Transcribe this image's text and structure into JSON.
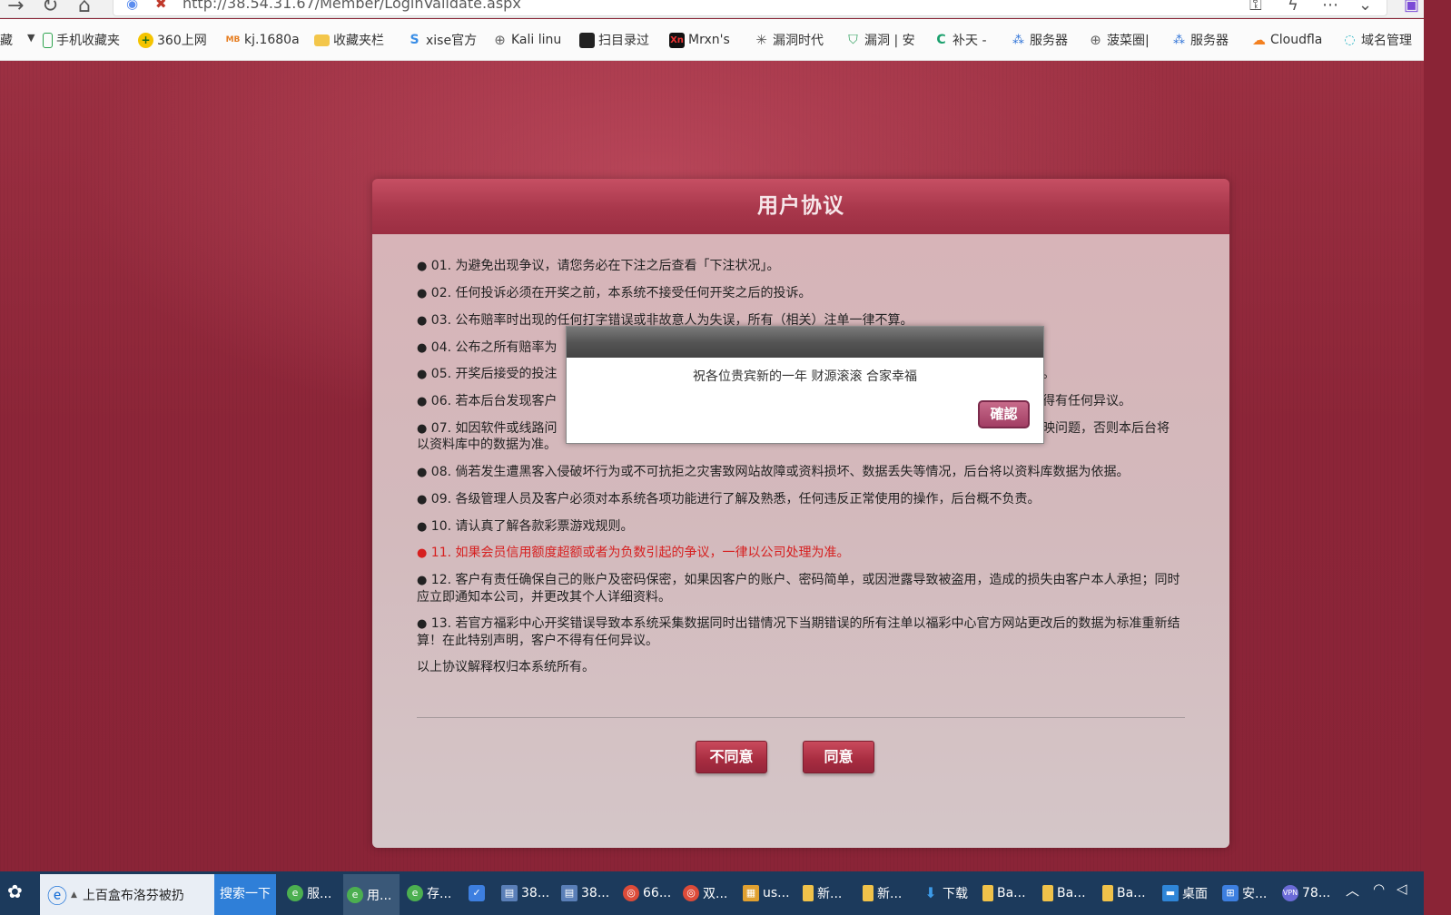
{
  "browser": {
    "url": "http://38.54.31.67/Member/LoginValidate.aspx",
    "bookmarks": [
      {
        "label": "藏",
        "icon": "bookmark-folder-icon"
      },
      {
        "label": "手机收藏夹",
        "icon": "phone-icon"
      },
      {
        "label": "360上网",
        "icon": "plus-globe-icon"
      },
      {
        "label": "kj.1680a",
        "icon": "mb-logo-icon"
      },
      {
        "label": "收藏夹栏",
        "icon": "folder-icon"
      },
      {
        "label": "xise官方",
        "icon": "s-logo-icon"
      },
      {
        "label": "Kali linu",
        "icon": "globe-icon"
      },
      {
        "label": "扫目录过",
        "icon": "dark-app-icon"
      },
      {
        "label": "Mrxn's",
        "icon": "xn-logo-icon"
      },
      {
        "label": "漏洞时代",
        "icon": "star-burst-icon"
      },
      {
        "label": "漏洞 | 安",
        "icon": "shield-icon"
      },
      {
        "label": "补天 -",
        "icon": "green-c-icon"
      },
      {
        "label": "服务器",
        "icon": "server-icon"
      },
      {
        "label": "菠菜圈|",
        "icon": "globe-icon"
      },
      {
        "label": "服务器",
        "icon": "server-icon"
      },
      {
        "label": "Cloudfla",
        "icon": "cloud-icon"
      },
      {
        "label": "域名管理",
        "icon": "domain-icon"
      }
    ]
  },
  "agreement": {
    "title": "用户协议",
    "clauses": [
      "01. 为避免出现争议，请您务必在下注之后查看「下注状况」。",
      "02. 任何投诉必须在开奖之前，本系统不接受任何开奖之后的投诉。",
      "03. 公布赔率时出现的任何打字错误或非故意人为失误，所有（相关）注单一律不算。",
      "04. 公布之所有赔率为",
      "05. 开奖后接受的投注",
      "06. 若本后台发现客户",
      "07. 如因软件或线路问",
      "08. 倘若发生遭黑客入侵破坏行为或不可抗拒之灾害致网站故障或资料损坏、数据丢失等情况，后台将以资料库数据为依据。",
      "09. 各级管理人员及客户必须对本系统各项功能进行了解及熟悉，任何违反正常使用的操作，后台概不负责。",
      "10. 请认真了解各款彩票游戏规则。",
      "11. 如果会员信用额度超额或者为负数引起的争议，一律以公司处理为准。",
      "12. 客户有责任确保自己的账户及密码保密，如果因客户的账户、密码简单，或因泄露导致被盗用，造成的损失由客户本人承担；同时应立即通知本公司，并更改其个人详细资料。",
      "13. 若官方福彩中心开奖错误导致本系统采集数据同时出错情况下当期错误的所有注单以福彩中心官方网站更改后的数据为标准重新结算！在此特别声明，客户不得有任何异议。"
    ],
    "fragment_06_right": "得有任何异议。",
    "fragment_07_right": "映问题，否则本后台将",
    "fragment_07_line2": "以资料库中的数据为准。",
    "fragment_05_right": "。",
    "footer_note": "以上协议解释权归本系统所有。",
    "disagree_label": "不同意",
    "agree_label": "同意",
    "highlight_color": "#d61f1f"
  },
  "dialog": {
    "message": "祝各位贵宾新的一年 财源滚滚 合家幸福",
    "ok_label": "確認"
  },
  "taskbar": {
    "ie_title": "上百盒布洛芬被扔",
    "search_label": "搜索一下",
    "items": [
      {
        "label": "服..."
      },
      {
        "label": "用..."
      },
      {
        "label": "存..."
      },
      {
        "label": ""
      },
      {
        "label": "38..."
      },
      {
        "label": "38..."
      },
      {
        "label": "66..."
      },
      {
        "label": "双..."
      },
      {
        "label": "us..."
      },
      {
        "label": "新..."
      },
      {
        "label": "新..."
      },
      {
        "label": "下载"
      },
      {
        "label": "Ba..."
      },
      {
        "label": "Ba..."
      },
      {
        "label": "Ba..."
      },
      {
        "label": "桌面"
      },
      {
        "label": "安..."
      },
      {
        "label": "78..."
      }
    ]
  }
}
